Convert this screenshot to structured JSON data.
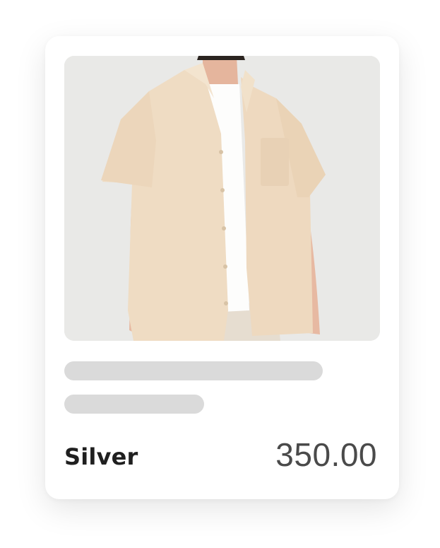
{
  "product": {
    "name": "Silver",
    "price": "350.00",
    "image_description_icon": "shirt-photo"
  },
  "colors": {
    "card_background": "#ffffff",
    "skeleton": "#dadada",
    "name_text": "#1f1f1f",
    "price_text": "#4a4a4a",
    "image_background": "#e9e9e7",
    "shirt": "#efdcc3"
  }
}
